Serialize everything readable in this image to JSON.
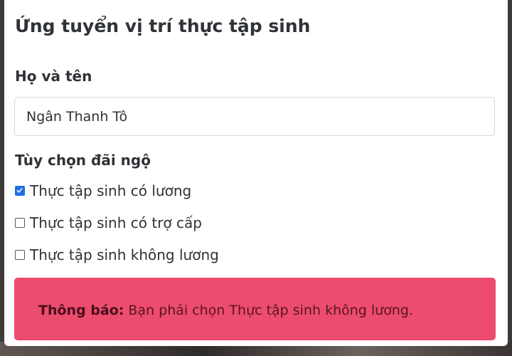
{
  "form": {
    "title": "Ứng tuyển vị trí thực tập sinh",
    "name_label": "Họ và tên",
    "name_value": "Ngân Thanh Tô",
    "options_label": "Tùy chọn đãi ngộ",
    "options": [
      {
        "label": "Thực tập sinh có lương",
        "checked": true
      },
      {
        "label": "Thực tập sinh có trợ cấp",
        "checked": false
      },
      {
        "label": "Thực tập sinh không lương",
        "checked": false
      }
    ]
  },
  "alert": {
    "title": "Thông báo:",
    "message": " Bạn phải chọn Thực tập sinh không lương."
  },
  "colors": {
    "alert_background": "#ec4c6e",
    "checkbox_accent": "#1f6fe5"
  }
}
